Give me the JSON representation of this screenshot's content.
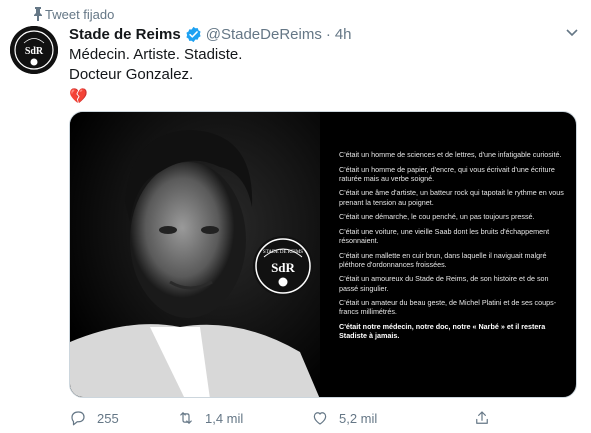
{
  "pinned_label": "Tweet fijado",
  "account": {
    "name": "Stade de Reims",
    "handle": "@StadeDeReims",
    "separator": "·",
    "time": "4h",
    "logo_text": "STADE DE REIMS",
    "logo_initials": "SdR"
  },
  "tweet": {
    "line1": "Médecin. Artiste. Stadiste.",
    "line2": "Docteur Gonzalez.",
    "emoji": "💔"
  },
  "media": {
    "logo_text": "STADE DE REIMS",
    "logo_initials": "SdR",
    "paragraphs": [
      "C'était un homme de sciences et de lettres, d'une infatigable curiosité.",
      "C'était un homme de papier, d'encre, qui vous écrivait d'une écriture raturée mais au verbe soigné.",
      "C'était une âme d'artiste, un batteur rock qui tapotait le rythme en vous prenant la tension au poignet.",
      "C'était une démarche, le cou penché, un pas toujours pressé.",
      "C'était une voiture, une vieille Saab dont les bruits d'échappement résonnaient.",
      "C'était une mallette en cuir brun, dans laquelle il naviguait malgré pléthore d'ordonnances froissées.",
      "C'était un amoureux du Stade de Reims, de son histoire et de son passé singulier.",
      "C'était un amateur du beau geste, de Michel Platini et de ses coups-francs millimétrés."
    ],
    "closing": "C'était notre médecin, notre doc, notre « Narbé » et il restera Stadiste à jamais."
  },
  "actions": {
    "replies": "255",
    "retweets": "1,4 mil",
    "likes": "5,2 mil"
  },
  "colors": {
    "text": "#14171a",
    "muted": "#657786",
    "verified": "#1da1f2"
  }
}
